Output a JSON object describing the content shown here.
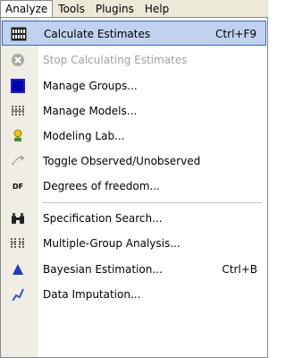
{
  "menubar": {
    "items": [
      {
        "label": "Analyze",
        "active": true
      },
      {
        "label": "Tools"
      },
      {
        "label": "Plugins"
      },
      {
        "label": "Help"
      }
    ]
  },
  "menu": {
    "items": [
      {
        "label": "Calculate Estimates",
        "shortcut": "Ctrl+F9",
        "icon": "calculate-estimates-icon"
      },
      {
        "label": "Stop Calculating Estimates",
        "icon": "stop-icon"
      },
      {
        "label": "Manage Groups...",
        "icon": "groups-icon"
      },
      {
        "label": "Manage Models...",
        "icon": "models-icon"
      },
      {
        "label": "Modeling Lab...",
        "icon": "modeling-lab-icon"
      },
      {
        "label": "Toggle Observed/Unobserved",
        "icon": "toggle-observed-icon"
      },
      {
        "label": "Degrees of freedom...",
        "icon": "df-icon",
        "icon_text": "DF"
      },
      {
        "label": "Specification Search...",
        "icon": "binoculars-icon"
      },
      {
        "label": "Multiple-Group Analysis...",
        "icon": "multiple-group-icon"
      },
      {
        "label": "Bayesian Estimation...",
        "shortcut": "Ctrl+B",
        "icon": "bayesian-icon"
      },
      {
        "label": "Data Imputation...",
        "icon": "data-imputation-icon"
      }
    ]
  },
  "colors": {
    "menubar_bg": "#ece9d8",
    "highlight_bg": "#c1d2ee",
    "highlight_border": "#316ac5",
    "disabled_text": "#a0a0a0",
    "gutter_bg": "#f0eee4"
  }
}
